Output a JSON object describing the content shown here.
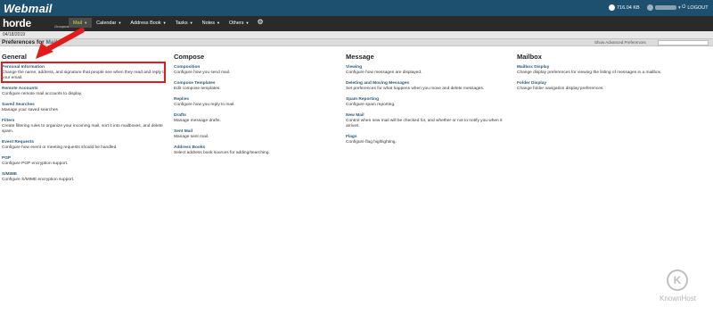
{
  "topbar": {
    "brand": "Webmail",
    "quota": "716.04 KB",
    "logout": "LOGOUT"
  },
  "navbar": {
    "logo": "horde",
    "logo_sub": "Groupware 5.2.22",
    "menu": [
      {
        "label": "Mail"
      },
      {
        "label": "Calendar"
      },
      {
        "label": "Address Book"
      },
      {
        "label": "Tasks"
      },
      {
        "label": "Notes"
      },
      {
        "label": "Others"
      }
    ]
  },
  "date": "04/18/2019",
  "title": {
    "prefix": "Preferences for",
    "module": "Mail",
    "advanced_link": "Show Advanced Preferences"
  },
  "columns": [
    {
      "heading": "General",
      "items": [
        {
          "title": "Personal Information",
          "desc": "Change the name, address, and signature that people see when they read and reply to your email."
        },
        {
          "title": "Remote Accounts",
          "desc": "Configure remote mail accounts to display."
        },
        {
          "title": "Saved Searches",
          "desc": "Manage your saved searches"
        },
        {
          "title": "Filters",
          "desc": "Create filtering rules to organize your incoming mail, sort it into mailboxes, and delete spam."
        },
        {
          "title": "Event Requests",
          "desc": "Configure how event or meeting requests should be handled."
        },
        {
          "title": "PGP",
          "desc": "Configure PGP encryption support."
        },
        {
          "title": "S/MIME",
          "desc": "Configure S/MIME encryption support."
        }
      ]
    },
    {
      "heading": "Compose",
      "items": [
        {
          "title": "Composition",
          "desc": "Configure how you send mail."
        },
        {
          "title": "Compose Templates",
          "desc": "Edit compose templates."
        },
        {
          "title": "Replies",
          "desc": "Configure how you reply to mail."
        },
        {
          "title": "Drafts",
          "desc": "Manage message drafts."
        },
        {
          "title": "Sent Mail",
          "desc": "Manage sent mail."
        },
        {
          "title": "Address Books",
          "desc": "Select address book sources for adding/searching."
        }
      ]
    },
    {
      "heading": "Message",
      "items": [
        {
          "title": "Viewing",
          "desc": "Configure how messages are displayed."
        },
        {
          "title": "Deleting and Moving Messages",
          "desc": "Set preferences for what happens when you move and delete messages."
        },
        {
          "title": "Spam Reporting",
          "desc": "Configure spam reporting."
        },
        {
          "title": "New Mail",
          "desc": "Control when new mail will be checked for, and whether or not to notify you when it arrives."
        },
        {
          "title": "Flags",
          "desc": "Configure flag highlighting."
        }
      ]
    },
    {
      "heading": "Mailbox",
      "items": [
        {
          "title": "Mailbox Display",
          "desc": "Change display preferences for viewing the listing of messages in a mailbox."
        },
        {
          "title": "Folder Display",
          "desc": "Change folder navigation display preferences."
        }
      ]
    }
  ],
  "watermark": {
    "logo_letter": "K",
    "text": "KnownHost"
  },
  "colors": {
    "topbar": "#1d4f6e",
    "navbar": "#2a2a2a",
    "active_menu": "#b9e04a",
    "link": "#2c5a7a",
    "highlight": "#e41b1b"
  }
}
